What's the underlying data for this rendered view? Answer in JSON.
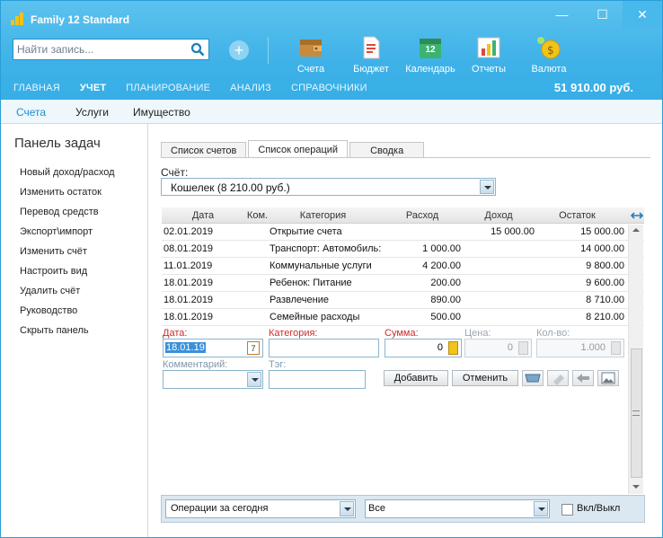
{
  "app": {
    "title": "Family 12 Standard"
  },
  "search": {
    "placeholder": "Найти запись..."
  },
  "toolbar": {
    "tools": [
      {
        "label": "Счета",
        "icon": "wallet-icon"
      },
      {
        "label": "Бюджет",
        "icon": "budget-document-icon"
      },
      {
        "label": "Календарь",
        "icon": "calendar-icon"
      },
      {
        "label": "Отчеты",
        "icon": "reports-chart-icon"
      },
      {
        "label": "Валюта",
        "icon": "currency-coin-icon"
      }
    ],
    "calendar_day": "12"
  },
  "main_nav": [
    "ГЛАВНАЯ",
    "УЧЕТ",
    "ПЛАНИРОВАНИЕ",
    "АНАЛИЗ",
    "СПРАВОЧНИКИ"
  ],
  "balance": "51 910.00 руб.",
  "sub_nav": [
    "Счета",
    "Услуги",
    "Имущество"
  ],
  "task_panel": {
    "title": "Панель задач",
    "items": [
      "Новый доход/расход",
      "Изменить остаток",
      "Перевод средств",
      "Экспорт\\импорт",
      "Изменить счёт",
      "Настроить вид",
      "Удалить счёт",
      "Руководство",
      "Скрыть панель"
    ]
  },
  "tabs": [
    "Список счетов",
    "Список операций",
    "Сводка"
  ],
  "account": {
    "label": "Счёт:",
    "value": "Кошелек (8 210.00 руб.)"
  },
  "grid": {
    "columns": [
      "Дата",
      "Ком.",
      "Категория",
      "Расход",
      "Доход",
      "Остаток"
    ],
    "rows": [
      {
        "date": "02.01.2019",
        "comment": "",
        "category": "Открытие счета",
        "expense": "",
        "income": "15 000.00",
        "balance": "15 000.00"
      },
      {
        "date": "08.01.2019",
        "comment": "",
        "category": "Транспорт: Автомобиль:",
        "expense": "1 000.00",
        "income": "",
        "balance": "14 000.00"
      },
      {
        "date": "11.01.2019",
        "comment": "",
        "category": "Коммунальные услуги",
        "expense": "4 200.00",
        "income": "",
        "balance": "9 800.00"
      },
      {
        "date": "18.01.2019",
        "comment": "",
        "category": "Ребенок: Питание",
        "expense": "200.00",
        "income": "",
        "balance": "9 600.00"
      },
      {
        "date": "18.01.2019",
        "comment": "",
        "category": "Развлечение",
        "expense": "890.00",
        "income": "",
        "balance": "8 710.00"
      },
      {
        "date": "18.01.2019",
        "comment": "",
        "category": "Семейные расходы",
        "expense": "500.00",
        "income": "",
        "balance": "8 210.00"
      }
    ]
  },
  "form": {
    "date_label": "Дата:",
    "date_value": "18.01.19",
    "date_icon_day": "7",
    "category_label": "Категория:",
    "category_value": "",
    "sum_label": "Сумма:",
    "sum_value": "0",
    "price_label": "Цена:",
    "price_value": "0",
    "qty_label": "Кол-во:",
    "qty_value": "1.000",
    "comment_label": "Комментарий:",
    "comment_value": "",
    "tag_label": "Тэг:",
    "tag_value": "",
    "add_label": "Добавить",
    "cancel_label": "Отменить"
  },
  "bottom": {
    "period": "Операции за сегодня",
    "filter": "Все",
    "toggle_label": "Вкл/Выкл"
  },
  "colors": {
    "accent": "#3fb2e8",
    "required": "#d12a2a",
    "gold": "#f2c318"
  }
}
